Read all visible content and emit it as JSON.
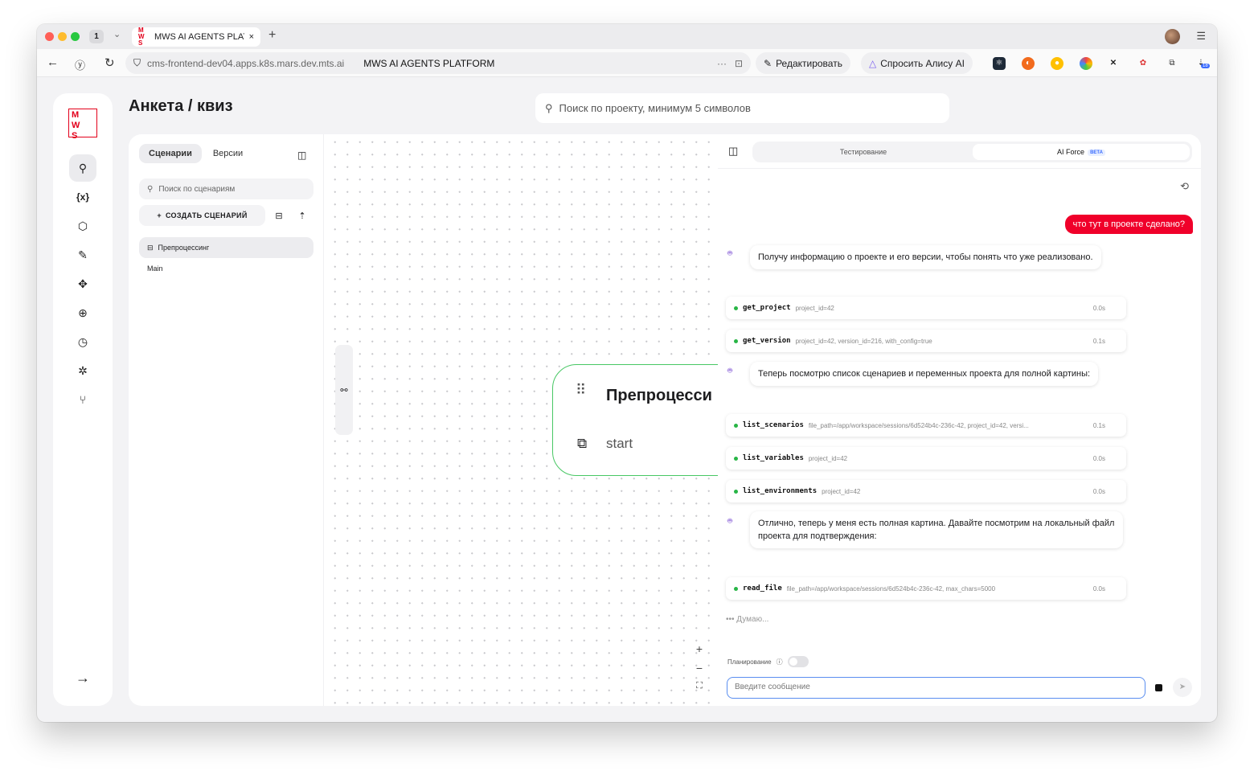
{
  "browser": {
    "tab_count": "1",
    "tab_title": "MWS AI AGENTS PLATI",
    "tab_favicon": "M W S",
    "url": "cms-frontend-dev04.apps.k8s.mars.dev.mts.ai",
    "page_title": "MWS AI AGENTS PLATFORM",
    "edit_label": "Редактировать",
    "alice_label": "Спросить Алису AI",
    "downloads_badge": "18"
  },
  "logo_text": "M W S",
  "page": {
    "title": "Анкета / квиз",
    "search_placeholder": "Поиск по проекту, минимум 5 символов"
  },
  "rail": {
    "icons": [
      "scenarios-icon",
      "variables-icon",
      "package-icon",
      "edit-doc-icon",
      "puzzle-icon",
      "globe-icon",
      "clock-icon",
      "bug-icon",
      "branch-icon"
    ],
    "variables_glyph": "{x}",
    "expand_glyph": "→"
  },
  "scenarios": {
    "tabs": [
      "Сценарии",
      "Версии"
    ],
    "search_placeholder": "Поиск по сценариям",
    "create_label": "СОЗДАТЬ СЦЕНАРИЙ",
    "items": [
      "Препроцессинг",
      "Main"
    ]
  },
  "canvas": {
    "node_title": "Препроцесси",
    "node_start": "start"
  },
  "chat": {
    "tabs": [
      "Тестирование",
      "AI Force"
    ],
    "beta_badge": "BETA",
    "user_message": "что тут в проекте сделано?",
    "assistant_messages": [
      "Получу информацию о проекте и его версии, чтобы понять что уже реализовано.",
      "Теперь посмотрю список сценариев и переменных проекта для полной картины:",
      "Отлично, теперь у меня есть полная картина. Давайте посмотрим на локальный файл проекта для подтверждения:"
    ],
    "tools": [
      {
        "name": "get_project",
        "args": "project_id=42",
        "time": "0.0s"
      },
      {
        "name": "get_version",
        "args": "project_id=42, version_id=216, with_config=true",
        "time": "0.1s"
      },
      {
        "name": "list_scenarios",
        "args": "file_path=/app/workspace/sessions/6d524b4c-236c-42, project_id=42, versi...",
        "time": "0.1s"
      },
      {
        "name": "list_variables",
        "args": "project_id=42",
        "time": "0.0s"
      },
      {
        "name": "list_environments",
        "args": "project_id=42",
        "time": "0.0s"
      },
      {
        "name": "read_file",
        "args": "file_path=/app/workspace/sessions/6d524b4c-236c-42, max_chars=5000",
        "time": "0.0s"
      }
    ],
    "thinking": "Думаю...",
    "planning_label": "Планирование",
    "planning_enabled": false,
    "input_placeholder": "Введите сообщение"
  }
}
